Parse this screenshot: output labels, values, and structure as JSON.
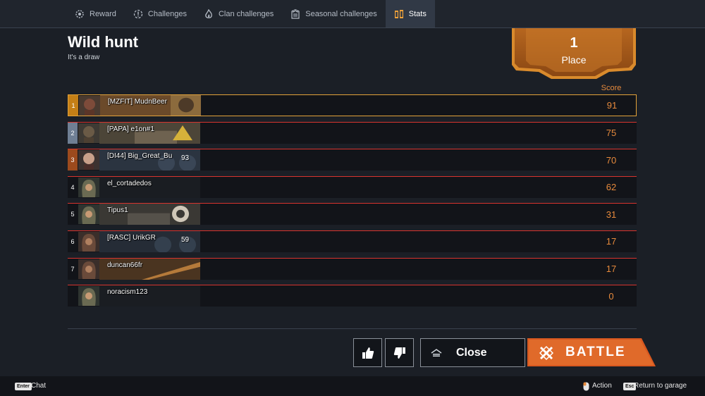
{
  "tabs": [
    {
      "label": "Reward",
      "icon": "gear-icon",
      "active": false
    },
    {
      "label": "Challenges",
      "icon": "challenges-icon",
      "active": false
    },
    {
      "label": "Clan challenges",
      "icon": "flame-icon",
      "active": false
    },
    {
      "label": "Seasonal challenges",
      "icon": "castle-icon",
      "active": false
    },
    {
      "label": "Stats",
      "icon": "stats-icon",
      "active": true
    }
  ],
  "event": {
    "title": "Wild hunt",
    "result": "It's a draw"
  },
  "place": {
    "number": "1",
    "label": "Place"
  },
  "table": {
    "score_header": "Score",
    "rows": [
      {
        "rank": "1",
        "name": "[MZFIT] MudnBeer",
        "level": "",
        "score": "91"
      },
      {
        "rank": "2",
        "name": "[PAPA] e1on#1",
        "level": "",
        "score": "75"
      },
      {
        "rank": "3",
        "name": "[DI44] Big_Great_Bu",
        "level": "93",
        "score": "70"
      },
      {
        "rank": "4",
        "name": "el_cortadedos",
        "level": "",
        "score": "62"
      },
      {
        "rank": "5",
        "name": "Tipus1",
        "level": "",
        "score": "31"
      },
      {
        "rank": "6",
        "name": "[RASC] UrikGR",
        "level": "59",
        "score": "17"
      },
      {
        "rank": "7",
        "name": "duncan66fr",
        "level": "",
        "score": "17"
      },
      {
        "rank": "",
        "name": "noracism123",
        "level": "",
        "score": "0"
      }
    ]
  },
  "buttons": {
    "close": "Close",
    "battle": "BATTLE"
  },
  "footer": {
    "chat_key": "Enter",
    "chat": "Chat",
    "action": "Action",
    "esc_key": "Esc",
    "return": "Return to garage"
  },
  "colors": {
    "accent": "#e78a3c",
    "battle": "#d9581f",
    "gold": "#e2a23a",
    "row_line": "#d8342e"
  }
}
